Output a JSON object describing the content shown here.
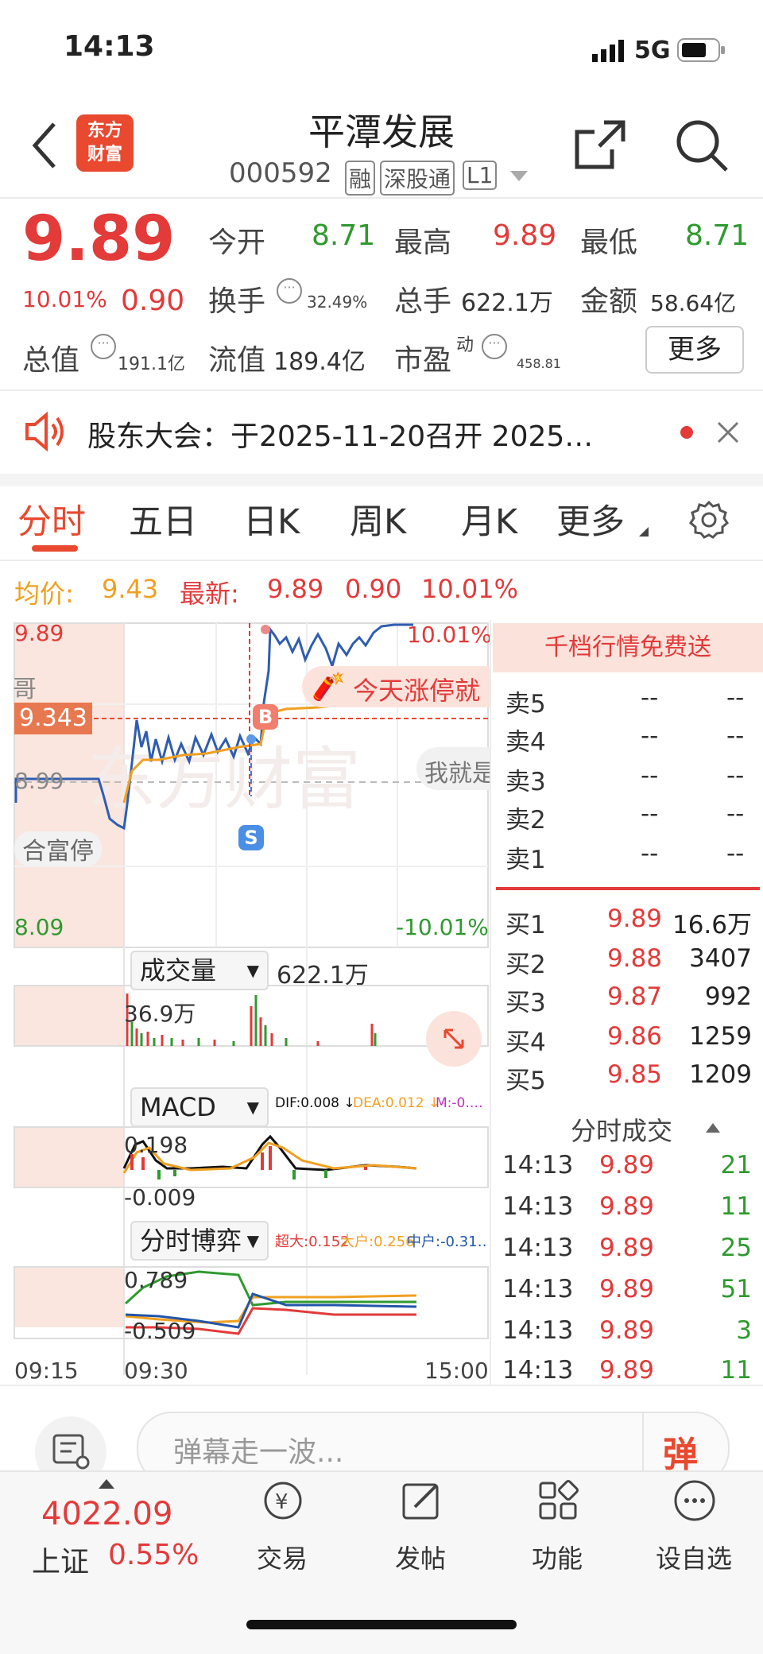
{
  "status_bar": {
    "time": "14:13",
    "network": "5G"
  },
  "header": {
    "app_logo": "东方\n财富",
    "stock_name": "平潭发展",
    "stock_code": "000592",
    "tags": [
      "融",
      "深股通",
      "L1"
    ]
  },
  "quote": {
    "price": "9.89",
    "change_pct": "10.01%",
    "change": "0.90",
    "open_label": "今开",
    "open": "8.71",
    "high_label": "最高",
    "high": "9.89",
    "low_label": "最低",
    "low": "8.71",
    "turnover_label": "换手",
    "turnover": "32.49%",
    "volume_label": "总手",
    "volume": "622.1万",
    "amount_label": "金额",
    "amount": "58.64亿",
    "mktcap_label": "总值",
    "mktcap": "191.1亿",
    "float_label": "流值",
    "float": "189.4亿",
    "pe_label": "市盈",
    "pe_sup": "动",
    "pe": "458.81",
    "more_button": "更多"
  },
  "notice": {
    "text": "股东大会：于2025-11-20召开 2025…"
  },
  "tabs": [
    "分时",
    "五日",
    "日K",
    "周K",
    "月K",
    "更多"
  ],
  "price_info": {
    "avg_label": "均价:",
    "avg": "9.43",
    "latest_label": "最新:",
    "latest": "9.89",
    "change": "0.90",
    "pct": "10.01%"
  },
  "chart": {
    "y_top": "9.89",
    "y_bottom": "8.09",
    "y_mid": "8.99",
    "pct_top": "10.01%",
    "pct_bottom": "-10.01%",
    "cursor_price": "9.343",
    "banner": "今天涨停就",
    "hint": "我就是",
    "left_note_1": "哥",
    "left_note_2": "合富停",
    "marker_b": "B",
    "marker_s": "S",
    "volume_label": "成交量",
    "volume_total": "622.1万",
    "volume_max": "36.9万",
    "macd_label": "MACD",
    "dif": "DIF:0.008 ↓",
    "dea": "DEA:0.012 ↓",
    "m": "M:-0.…",
    "macd_top": "0.198",
    "macd_bottom": "-0.009",
    "game_label": "分时博弈",
    "super": "超大:0.152",
    "large": "大户:0.256",
    "mid": "中户:-0.31…",
    "game_top": "0.789",
    "game_bottom": "-0.509",
    "x_labels": [
      "09:15",
      "09:30",
      "15:00"
    ],
    "colors": {
      "red": "#e33a3a",
      "green": "#2f9a2f",
      "orange": "#f0a020",
      "blue": "#2255aa"
    }
  },
  "orderbook": {
    "promo": "千档行情免费送",
    "asks": [
      {
        "label": "卖5",
        "price": "--",
        "vol": "--"
      },
      {
        "label": "卖4",
        "price": "--",
        "vol": "--"
      },
      {
        "label": "卖3",
        "price": "--",
        "vol": "--"
      },
      {
        "label": "卖2",
        "price": "--",
        "vol": "--"
      },
      {
        "label": "卖1",
        "price": "--",
        "vol": "--"
      }
    ],
    "bids": [
      {
        "label": "买1",
        "price": "9.89",
        "vol": "16.6万"
      },
      {
        "label": "买2",
        "price": "9.88",
        "vol": "3407"
      },
      {
        "label": "买3",
        "price": "9.87",
        "vol": "992"
      },
      {
        "label": "买4",
        "price": "9.86",
        "vol": "1259"
      },
      {
        "label": "买5",
        "price": "9.85",
        "vol": "1209"
      }
    ],
    "trades_title": "分时成交",
    "trades": [
      {
        "time": "14:13",
        "price": "9.89",
        "vol": "21"
      },
      {
        "time": "14:13",
        "price": "9.89",
        "vol": "11"
      },
      {
        "time": "14:13",
        "price": "9.89",
        "vol": "25"
      },
      {
        "time": "14:13",
        "price": "9.89",
        "vol": "51"
      },
      {
        "time": "14:13",
        "price": "9.89",
        "vol": "3"
      },
      {
        "time": "14:13",
        "price": "9.89",
        "vol": "11"
      }
    ]
  },
  "comment": {
    "placeholder": "弹幕走一波...",
    "danmu_button": "弹"
  },
  "bottom_nav": {
    "index_value": "4022.09",
    "index_name": "上证",
    "index_pct": "0.55%",
    "items": [
      "交易",
      "发帖",
      "功能",
      "设自选"
    ]
  }
}
